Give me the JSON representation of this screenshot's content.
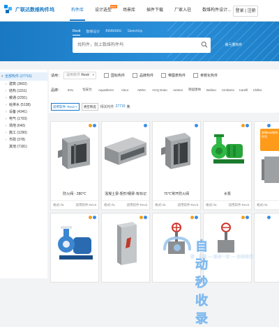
{
  "colors": {
    "brand": "#1677c8",
    "hero": "#1f84d0",
    "hot_badge": "#ff7a1a"
  },
  "header": {
    "logo_text": "广联达数维构件坞",
    "nav": [
      {
        "label": "构件库",
        "active": true
      },
      {
        "label": "设计选型",
        "badge": "HOT"
      },
      {
        "label": "场景库"
      },
      {
        "label": "插件下载"
      },
      {
        "label": "厂家入驻"
      },
      {
        "label": "数维构件设计..."
      }
    ],
    "login_label": "登录 | 注册"
  },
  "search": {
    "tabs": [
      "Revit",
      "数维设计",
      "BIMMAKE",
      "SketchUp"
    ],
    "placeholder": "找构件，就上数维构件坞",
    "want_button": "我亏要构件"
  },
  "sidebar": {
    "items": [
      {
        "label": "全部构件 (27715)",
        "icon": "chevron-down-icon"
      },
      {
        "label": "建筑 (3602)",
        "icon": "chevron-right-icon"
      },
      {
        "label": "结构 (1151)",
        "icon": "chevron-right-icon"
      },
      {
        "label": "暖通 (2291)",
        "icon": "chevron-right-icon"
      },
      {
        "label": "给排水 (5138)",
        "icon": "chevron-right-icon"
      },
      {
        "label": "设备 (4341)",
        "icon": "chevron-right-icon"
      },
      {
        "label": "电气 (1703)",
        "icon": "chevron-right-icon"
      },
      {
        "label": "场地 (640)",
        "icon": "chevron-right-icon"
      },
      {
        "label": "施工 (1290)",
        "icon": "chevron-right-icon"
      },
      {
        "label": "市政 (378)",
        "icon": "chevron-right-icon"
      },
      {
        "label": "其他 (7181)",
        "icon": ""
      }
    ]
  },
  "filters": {
    "applies_label": "适用：",
    "applies_select_label": "适用软件",
    "applies_select_value": "Revit",
    "checkboxes": [
      "国标构件",
      "品牌构件",
      "带图表构件",
      "参数化构件"
    ],
    "brand_label": "品牌：",
    "brands": [
      "3VU",
      "恒安达",
      "Aquatherm",
      "Alnor",
      "AERA",
      "ACQ Drain",
      "Aerteci",
      "德国唐纳",
      "Belimo",
      "Cimberio",
      "Camfil",
      "Chiller"
    ],
    "active_tags": [
      "适用软件: Revit ×",
      "清空筛选"
    ],
    "count_prefix": "相关构件",
    "count": "27715",
    "count_suffix": "条"
  },
  "cards_row1": [
    {
      "title": "防火阀 - 280℃",
      "foot_left": "格式:rfa",
      "foot_right": "适用软件:Revit"
    },
    {
      "title": "混凝土梁-矩形/钢梁-有标记",
      "foot_left": "格式:rfa",
      "foot_right": "适用软件:Revit"
    },
    {
      "title": "70℃常开防火阀",
      "foot_left": "格式:rfa",
      "foot_right": "适用软件:Revit"
    },
    {
      "title": "水泵",
      "foot_left": "格式:rfa",
      "foot_right": "适用软件:Revit"
    },
    {
      "title": "",
      "foot_left": "格式:rfa",
      "foot_right": "",
      "promo": "安装BIM装构件坞"
    }
  ],
  "watermark": {
    "title": "自动秒收录",
    "subtitle": "数 · 互联 — 来访一次 — 自动收录"
  }
}
